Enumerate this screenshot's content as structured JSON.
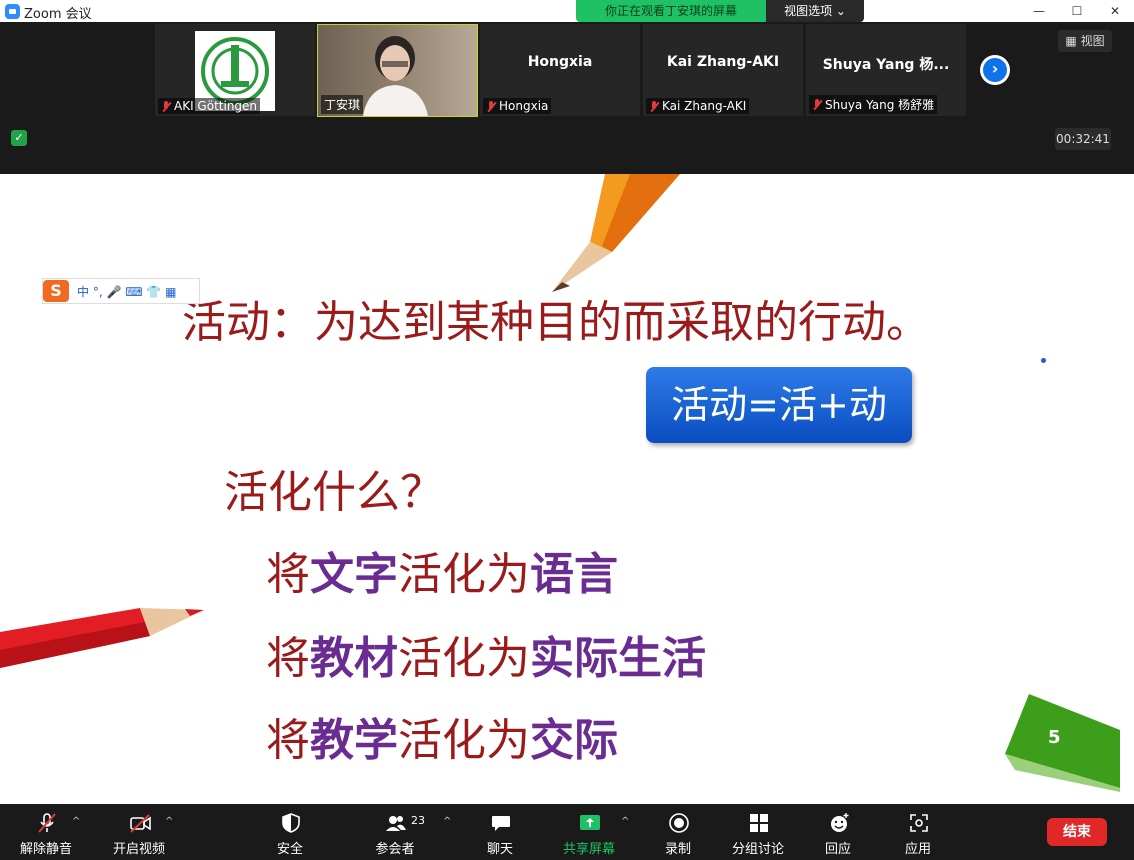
{
  "window": {
    "title": "Zoom 会议"
  },
  "share_bar": {
    "status": "你正在观看丁安琪的屏幕",
    "options_label": "视图选项 ⌄"
  },
  "participants": [
    {
      "display": "",
      "tag": "AKI Göttingen"
    },
    {
      "display": "",
      "tag": "丁安琪"
    },
    {
      "display": "Hongxia",
      "tag": "Hongxia"
    },
    {
      "display": "Kai Zhang-AKI",
      "tag": "Kai Zhang-AKI"
    },
    {
      "display": "Shuya  Yang 杨...",
      "tag": "Shuya Yang 杨舒雅"
    }
  ],
  "view_button": "视图",
  "timer": "00:32:41",
  "slide": {
    "title": "活动：为达到某种目的而采取的行动。",
    "box": "活动=活+动",
    "question": "活化什么？",
    "lines": [
      [
        "将",
        "文字",
        "活化为",
        "语言"
      ],
      [
        "将",
        "教材",
        "活化为",
        "实际生活"
      ],
      [
        "将",
        "教学",
        "活化为",
        "交际"
      ]
    ],
    "page_number": "5"
  },
  "ime": {
    "logo": "S",
    "text": "中 °, 🎤 ⌨ 👕 ▦"
  },
  "toolbar": {
    "unmute": "解除静音",
    "start_video": "开启视频",
    "security": "安全",
    "participants": "参会者",
    "participants_count": "23",
    "chat": "聊天",
    "share": "共享屏幕",
    "record": "录制",
    "breakout": "分组讨论",
    "reactions": "回应",
    "apps": "应用",
    "end": "结束"
  }
}
